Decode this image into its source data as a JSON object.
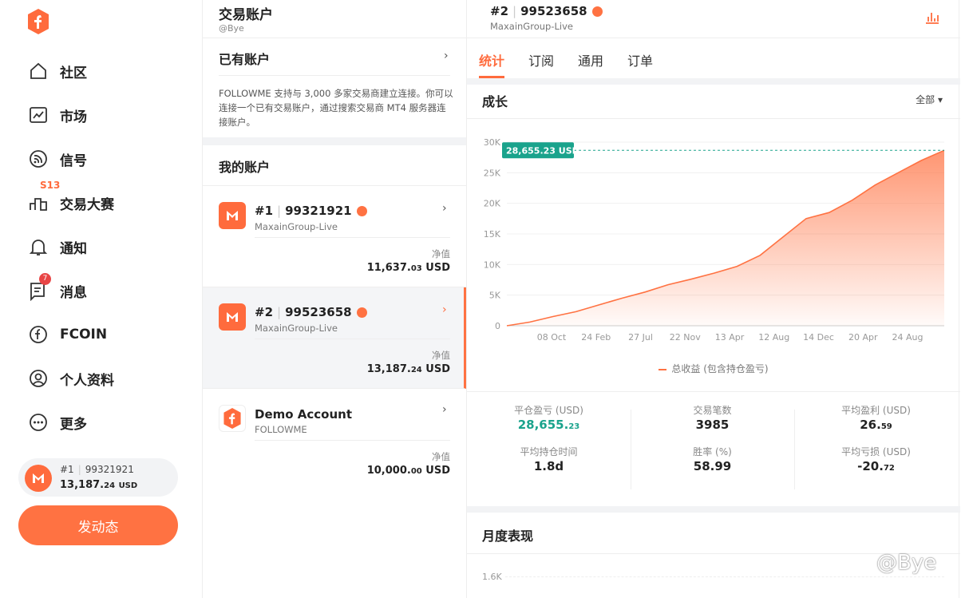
{
  "nav": {
    "items": [
      {
        "label": "社区",
        "icon": "home-icon"
      },
      {
        "label": "市场",
        "icon": "market-chart-icon"
      },
      {
        "label": "信号",
        "icon": "signal-icon"
      },
      {
        "label": "交易大赛",
        "icon": "contest-icon",
        "badge": "S13"
      },
      {
        "label": "通知",
        "icon": "bell-icon"
      },
      {
        "label": "消息",
        "icon": "message-icon",
        "badge": "7"
      },
      {
        "label": "FCOIN",
        "icon": "fcoin-icon"
      },
      {
        "label": "个人资料",
        "icon": "profile-icon"
      },
      {
        "label": "更多",
        "icon": "more-icon"
      }
    ],
    "mini_account": {
      "num": "#1",
      "id": "99321921",
      "equity_main": "13,187.",
      "equity_dec": "24",
      "unit": "USD"
    },
    "post_button": "发动态"
  },
  "middle": {
    "title": "交易账户",
    "subtitle": "@Bye",
    "existing_title": "已有账户",
    "description": "FOLLOWME 支持与 3,000 多家交易商建立连接。你可以连接一个已有交易账户，通过搜索交易商 MT4 服务器连接账户。",
    "my_accounts_title": "我的账户",
    "equity_label": "净值",
    "accounts": [
      {
        "num": "#1",
        "id": "99321921",
        "server": "MaxainGroup-Live",
        "equity_main": "11,637.",
        "equity_dec": "03",
        "unit": "USD"
      },
      {
        "num": "#2",
        "id": "99523658",
        "server": "MaxainGroup-Live",
        "equity_main": "13,187.",
        "equity_dec": "24",
        "unit": "USD"
      },
      {
        "name": "Demo Account",
        "server": "FOLLOWME",
        "equity_main": "10,000.",
        "equity_dec": "00",
        "unit": "USD"
      }
    ]
  },
  "right": {
    "num": "#2",
    "id": "99523658",
    "server": "MaxainGroup-Live",
    "tabs": [
      "统计",
      "订阅",
      "通用",
      "订单"
    ],
    "growth_title": "成长",
    "filter": "全部",
    "legend": "总收益 (包含持仓盈亏)",
    "current_label": "28,655.23 USD",
    "stats": [
      {
        "label": "平仓盈亏 (USD)",
        "main": "28,655.",
        "dec": "23",
        "green": true
      },
      {
        "label": "交易笔数",
        "main": "3985",
        "dec": ""
      },
      {
        "label": "平均盈利 (USD)",
        "main": "26.",
        "dec": "59"
      },
      {
        "label": "平均持仓时间",
        "main": "1.8d",
        "dec": ""
      },
      {
        "label": "胜率 (%)",
        "main": "58.99",
        "dec": ""
      },
      {
        "label": "平均亏损 (USD)",
        "main": "-20.",
        "dec": "72"
      }
    ],
    "monthly_title": "月度表现",
    "monthly_tick": "1.6K"
  },
  "chart_data": {
    "type": "area",
    "y_ticks": [
      "0",
      "5K",
      "10K",
      "15K",
      "20K",
      "25K",
      "30K"
    ],
    "x_ticks": [
      "08 Oct",
      "24 Feb",
      "27 Jul",
      "22 Nov",
      "13 Apr",
      "12 Aug",
      "14 Dec",
      "20 Apr",
      "24 Aug"
    ],
    "ylim": [
      0,
      30000
    ],
    "series": [
      {
        "name": "总收益 (包含持仓盈亏)",
        "color": "#ff7242",
        "values": [
          0,
          600,
          1500,
          2300,
          3400,
          4500,
          5500,
          6700,
          7600,
          8600,
          9700,
          11500,
          14500,
          17500,
          18500,
          20500,
          23000,
          25000,
          27000,
          28655
        ]
      }
    ],
    "grid": true
  },
  "watermark": "@Bye"
}
